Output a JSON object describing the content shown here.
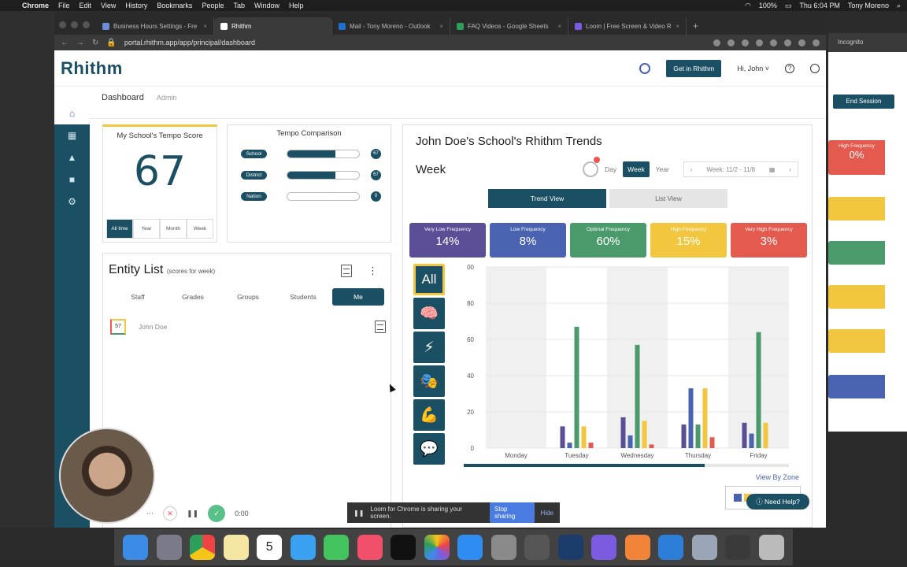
{
  "menubar": {
    "app": "Chrome",
    "items": [
      "File",
      "Edit",
      "View",
      "History",
      "Bookmarks",
      "People",
      "Tab",
      "Window",
      "Help"
    ],
    "battery": "100%",
    "datetime": "Thu 6:04 PM",
    "user": "Tony Moreno"
  },
  "browser": {
    "tabs": [
      {
        "label": "Business Hours Settings - Fre",
        "active": false
      },
      {
        "label": "Rhithm",
        "active": true
      },
      {
        "label": "Mail - Tony Moreno - Outlook",
        "active": false
      },
      {
        "label": "FAQ Videos - Google Sheets",
        "active": false
      },
      {
        "label": "Loom | Free Screen & Video R",
        "active": false
      }
    ],
    "url": "portal.rhithm.app/app/principal/dashboard",
    "incognito": "Incognito"
  },
  "header": {
    "logo": "Rhithm",
    "get_in": "Get in Rhithm",
    "user_menu": "Hi, John ˅"
  },
  "breadcrumb": {
    "dashboard": "Dashboard",
    "admin": "Admin"
  },
  "tempo_score": {
    "title": "My School's Tempo Score",
    "value": "67",
    "tabs": [
      "All time",
      "Year",
      "Month",
      "Week"
    ]
  },
  "tempo_comparison": {
    "title": "Tempo Comparison",
    "rows": [
      {
        "label": "School",
        "value": "67",
        "fill": 0.67
      },
      {
        "label": "District",
        "value": "67",
        "fill": 0.67
      },
      {
        "label": "Nation",
        "value": "0",
        "fill": 0
      }
    ]
  },
  "entity_list": {
    "title": "Entity List",
    "subtitle": "(scores for week)",
    "tabs": [
      "Staff",
      "Grades",
      "Groups",
      "Students",
      "Me"
    ],
    "rows": [
      {
        "score": "57",
        "name": "John Doe"
      }
    ]
  },
  "trends": {
    "title": "John Doe's School's Rhithm Trends",
    "period_label": "Week",
    "periods": [
      "Day",
      "Week",
      "Year"
    ],
    "week_range": "Week: 11/2 - 11/8",
    "views": [
      "Trend View",
      "List View"
    ],
    "zones": [
      {
        "label": "Very Low Frequency",
        "value": "14%",
        "color": "#5b4e96"
      },
      {
        "label": "Low Frequency",
        "value": "8%",
        "color": "#4a63b0"
      },
      {
        "label": "Optimal Frequency",
        "value": "60%",
        "color": "#4a9a6b"
      },
      {
        "label": "High Frequency",
        "value": "15%",
        "color": "#f3c63f"
      },
      {
        "label": "Very High Frequency",
        "value": "3%",
        "color": "#e45a4f"
      }
    ],
    "filters": [
      {
        "name": "all",
        "label": "All"
      },
      {
        "name": "brain-icon",
        "glyph": "🧠"
      },
      {
        "name": "lightning-icon",
        "glyph": "⚡"
      },
      {
        "name": "masks-icon",
        "glyph": "🎭"
      },
      {
        "name": "muscle-icon",
        "glyph": "💪"
      },
      {
        "name": "speech-bubble-icon",
        "glyph": "💬"
      }
    ],
    "view_by_zone": "View By Zone"
  },
  "chart_data": {
    "type": "bar",
    "categories": [
      "Monday",
      "Tuesday",
      "Wednesday",
      "Thursday",
      "Friday"
    ],
    "ylim": [
      0,
      100
    ],
    "yticks": [
      "0",
      "20",
      "40",
      "60",
      "80",
      "00"
    ],
    "series": [
      {
        "color": "#5b4e96",
        "values": [
          0,
          12,
          17,
          13,
          14
        ]
      },
      {
        "color": "#4a63b0",
        "values": [
          0,
          3,
          7,
          33,
          8
        ]
      },
      {
        "color": "#4a9a6b",
        "values": [
          0,
          67,
          57,
          13,
          64
        ]
      },
      {
        "color": "#f3c63f",
        "values": [
          0,
          12,
          15,
          33,
          14
        ]
      },
      {
        "color": "#e45a4f",
        "values": [
          0,
          3,
          2,
          6,
          0
        ]
      }
    ],
    "grid": true
  },
  "right_window": {
    "end_session": "End Session",
    "zone_label": "High Frequency",
    "zone_value": "0%"
  },
  "loom": {
    "timer": "0:00",
    "sharing": "Loom for Chrome is sharing your screen.",
    "stop": "Stop sharing",
    "hide": "Hide"
  },
  "help": {
    "need_help": "Need Help?"
  },
  "dock": {
    "calendar_day": "5"
  }
}
